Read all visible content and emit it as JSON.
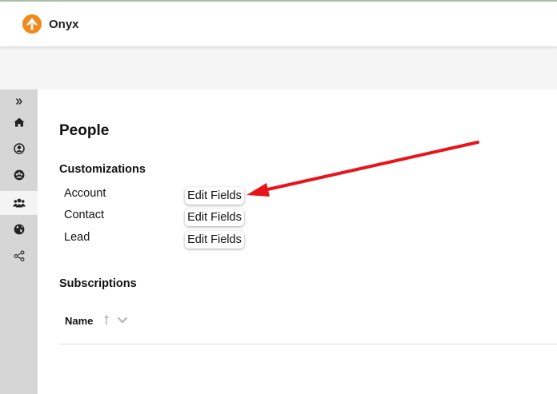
{
  "app": {
    "brand": "Onyx"
  },
  "sidebar": {
    "items": [
      {
        "icon": "expand-chevrons-icon"
      },
      {
        "icon": "home-icon"
      },
      {
        "icon": "user-circle-icon"
      },
      {
        "icon": "team-circle-icon"
      },
      {
        "icon": "people-icon",
        "active": true
      },
      {
        "icon": "globe-icon"
      },
      {
        "icon": "share-nodes-icon"
      }
    ]
  },
  "page": {
    "title": "People",
    "customizations": {
      "heading": "Customizations",
      "rows": [
        {
          "label": "Account",
          "button": "Edit Fields"
        },
        {
          "label": "Contact",
          "button": "Edit Fields"
        },
        {
          "label": "Lead",
          "button": "Edit Fields"
        }
      ]
    },
    "subscriptions": {
      "heading": "Subscriptions",
      "columns": [
        {
          "label": "Name",
          "sort": "ascending"
        }
      ]
    }
  },
  "annotation": {
    "color": "#e8141c"
  }
}
